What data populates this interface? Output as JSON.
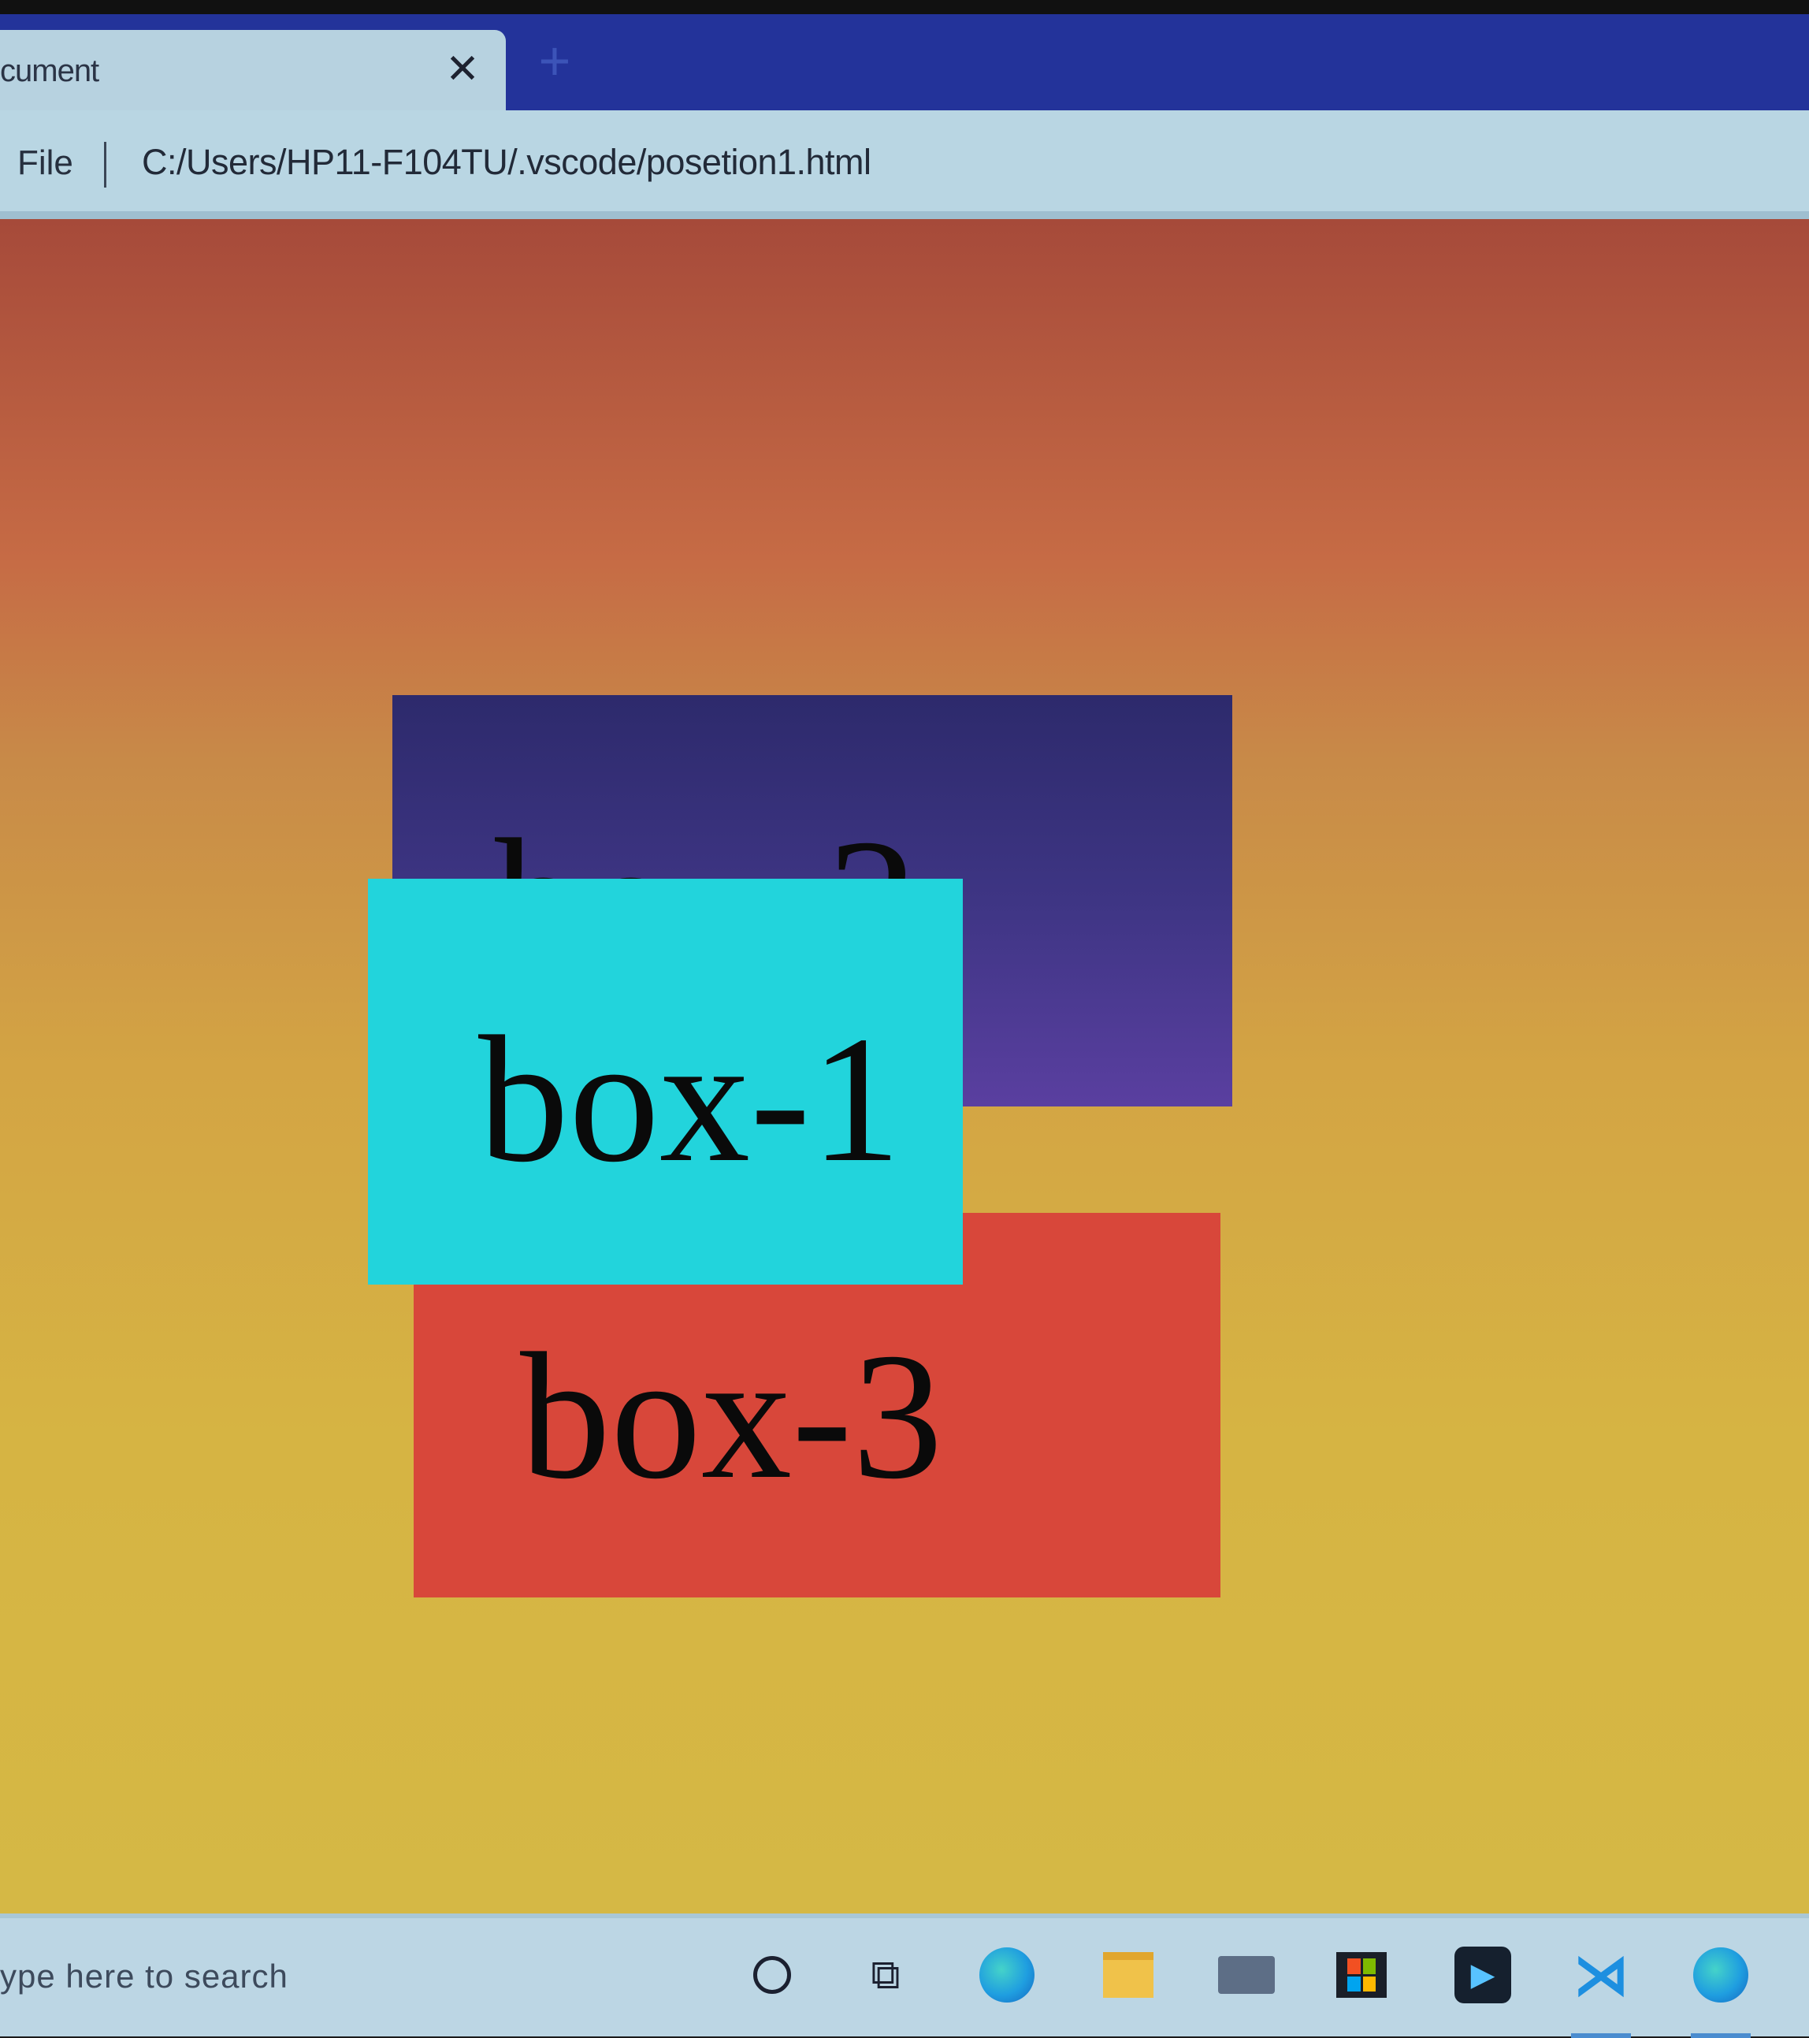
{
  "browser": {
    "tab": {
      "title": "cument",
      "close_glyph": "✕"
    },
    "new_tab_glyph": "+",
    "address": {
      "scheme_label": "File",
      "url": "C:/Users/HP11-F104TU/.vscode/posetion1.html"
    }
  },
  "page": {
    "boxes": [
      {
        "label": "box-1",
        "color": "#22d4dc"
      },
      {
        "label": "box-2",
        "color": "#3e3584"
      },
      {
        "label": "box-3",
        "color": "#d8473a"
      }
    ]
  },
  "taskbar": {
    "search_placeholder": "ype here to search",
    "icons": [
      "cortana-icon",
      "task-view-icon",
      "edge-icon",
      "file-explorer-icon",
      "mail-icon",
      "store-icon",
      "media-player-icon",
      "vscode-icon",
      "edge-icon"
    ]
  }
}
